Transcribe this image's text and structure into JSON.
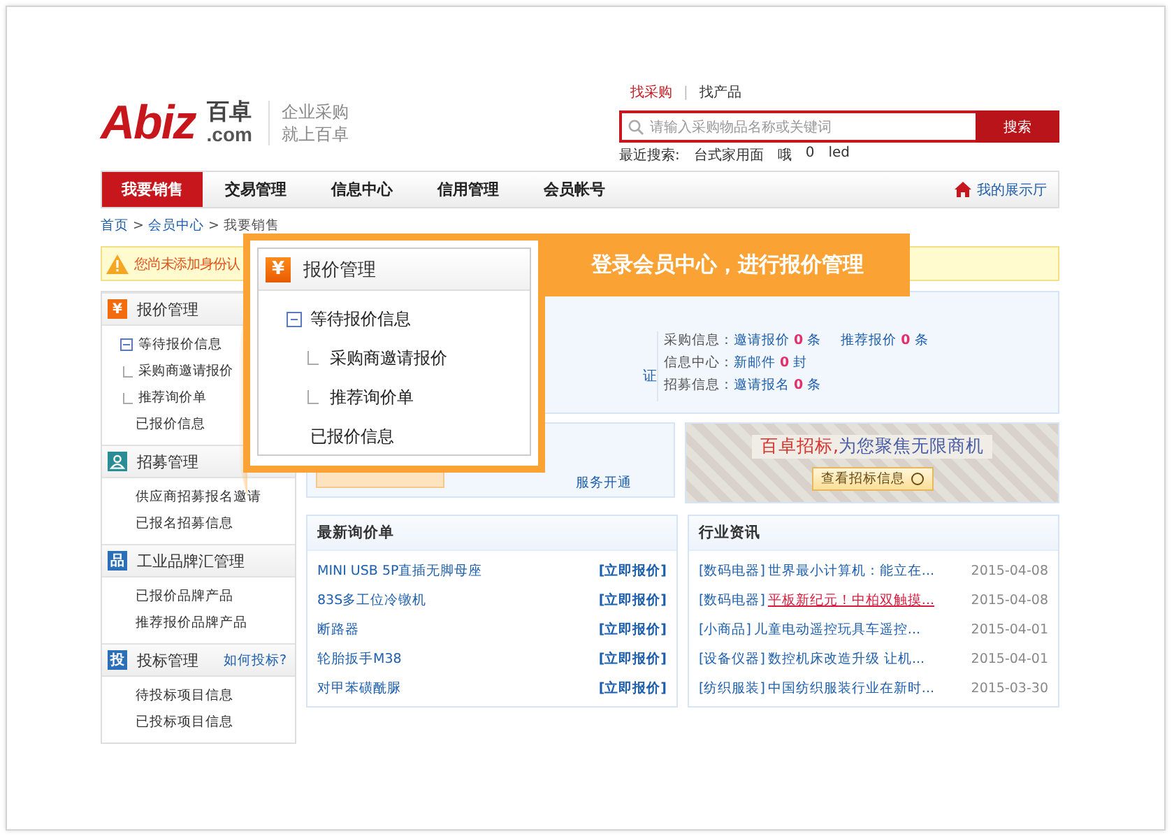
{
  "header": {
    "logo": {
      "mark": "Abiz",
      "name": "百卓",
      "domain": ".com"
    },
    "slogan": [
      "企业采购",
      "就上百卓"
    ]
  },
  "search": {
    "tabs": [
      {
        "label": "找采购",
        "selected": true
      },
      {
        "label": "找产品",
        "selected": false
      }
    ],
    "separator": "|",
    "placeholder": "请输入采购物品名称或关键词",
    "button": "搜索",
    "recent_label": "最近搜索:",
    "recent": [
      "台式家用面",
      "哦",
      "0",
      "led"
    ]
  },
  "nav": {
    "items": [
      {
        "label": "我要销售",
        "selected": true
      },
      {
        "label": "交易管理",
        "selected": false
      },
      {
        "label": "信息中心",
        "selected": false
      },
      {
        "label": "信用管理",
        "selected": false
      },
      {
        "label": "会员帐号",
        "selected": false
      }
    ],
    "right_link": "我的展示厅"
  },
  "breadcrumb": {
    "items": [
      "首页",
      "会员中心",
      "我要销售"
    ],
    "separator": ">"
  },
  "warning": "您尚未添加身份认",
  "sidebar": {
    "sections": [
      {
        "title": "报价管理",
        "icon": {
          "kind": "glyph",
          "text": "¥"
        },
        "color": "#f26b0f",
        "items": [
          {
            "label": "等待报价信息",
            "expanded": true,
            "children": [
              {
                "label": "采购商邀请报价"
              },
              {
                "label": "推荐询价单"
              }
            ]
          },
          {
            "label": "已报价信息"
          }
        ]
      },
      {
        "title": "招募管理",
        "icon": {
          "kind": "person"
        },
        "color": "#2a8c95",
        "items": [
          {
            "label": "供应商招募报名邀请"
          },
          {
            "label": "已报名招募信息"
          }
        ]
      },
      {
        "title": "工业品牌汇管理",
        "icon": {
          "kind": "glyph",
          "text": "品"
        },
        "color": "#2a6fb8",
        "items": [
          {
            "label": "已报价品牌产品"
          },
          {
            "label": "推荐报价品牌产品"
          }
        ]
      },
      {
        "title": "投标管理",
        "icon": {
          "kind": "glyph",
          "text": "投"
        },
        "color": "#2a6fb8",
        "link": "如何投标?",
        "items": [
          {
            "label": "待投标项目信息"
          },
          {
            "label": "已投标项目信息"
          }
        ]
      }
    ]
  },
  "info_panel": {
    "partial_link": "证",
    "stats": [
      {
        "label": "采购信息：",
        "entries": [
          {
            "link": "邀请报价",
            "count": "0",
            "unit": "条"
          },
          {
            "link": "推荐报价",
            "count": "0",
            "unit": "条"
          }
        ]
      },
      {
        "label": "信息中心：",
        "entries": [
          {
            "link": "新邮件",
            "count": "0",
            "unit": "封"
          }
        ]
      },
      {
        "label": "招募信息：",
        "entries": [
          {
            "link": "邀请报名",
            "count": "0",
            "unit": "条"
          }
        ]
      }
    ]
  },
  "service_box": {
    "link": "服务开通"
  },
  "banner": {
    "highlight": "百卓招标,",
    "text": "为您聚焦无限商机",
    "button": "查看招标信息"
  },
  "inquiries": {
    "title": "最新询价单",
    "rows": [
      {
        "title": "MINI USB 5P直插无脚母座",
        "action": "[立即报价]"
      },
      {
        "title": "83S多工位冷镦机",
        "action": "[立即报价]"
      },
      {
        "title": "断路器",
        "action": "[立即报价]"
      },
      {
        "title": "轮胎扳手M38",
        "action": "[立即报价]"
      },
      {
        "title": "对甲苯磺酰脲",
        "action": "[立即报价]"
      }
    ]
  },
  "news": {
    "title": "行业资讯",
    "rows": [
      {
        "category": "[数码电器]",
        "title": "世界最小计算机：能立在...",
        "date": "2015-04-08",
        "hovered": false
      },
      {
        "category": "[数码电器]",
        "title": "平板新纪元！中柏双触摸...",
        "date": "2015-04-08",
        "hovered": true
      },
      {
        "category": "[小商品]",
        "title": "儿童电动遥控玩具车遥控...",
        "date": "2015-04-01",
        "hovered": false
      },
      {
        "category": "[设备仪器]",
        "title": "数控机床改造升级 让机...",
        "date": "2015-04-01",
        "hovered": false
      },
      {
        "category": "[纺织服装]",
        "title": "中国纺织服装行业在新时...",
        "date": "2015-03-30",
        "hovered": false
      }
    ]
  },
  "callout": {
    "title": "报价管理",
    "icon": "¥",
    "items": [
      {
        "label": "等待报价信息",
        "expanded": true,
        "children": [
          {
            "label": "采购商邀请报价"
          },
          {
            "label": "推荐询价单"
          }
        ]
      },
      {
        "label": "已报价信息"
      }
    ],
    "banner": "登录会员中心，进行报价管理"
  }
}
